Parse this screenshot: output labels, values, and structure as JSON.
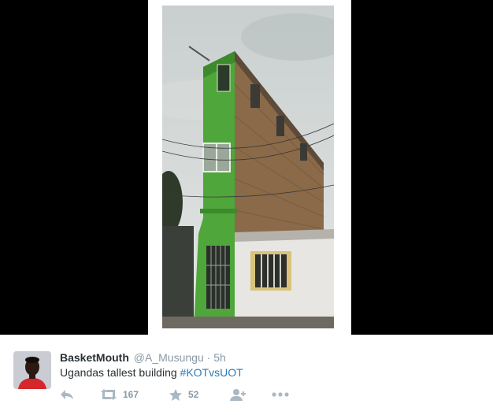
{
  "tweet": {
    "display_name": "BasketMouth",
    "handle": "@A_Musungu",
    "separator": "·",
    "timestamp": "5h",
    "text": "Ugandas tallest building",
    "hashtag": "#KOTvsUOT"
  },
  "actions": {
    "reply_icon": "reply-icon",
    "retweet_icon": "retweet-icon",
    "retweet_count": "167",
    "favorite_icon": "star-icon",
    "favorite_count": "52",
    "follow_icon": "follow-user-icon",
    "more_icon": "more-dots-icon"
  },
  "colors": {
    "media_background": "#000000",
    "name": "#292f33",
    "meta": "#8899a6",
    "hashtag": "#2b7bb9",
    "action_icon": "#aab8c2"
  }
}
